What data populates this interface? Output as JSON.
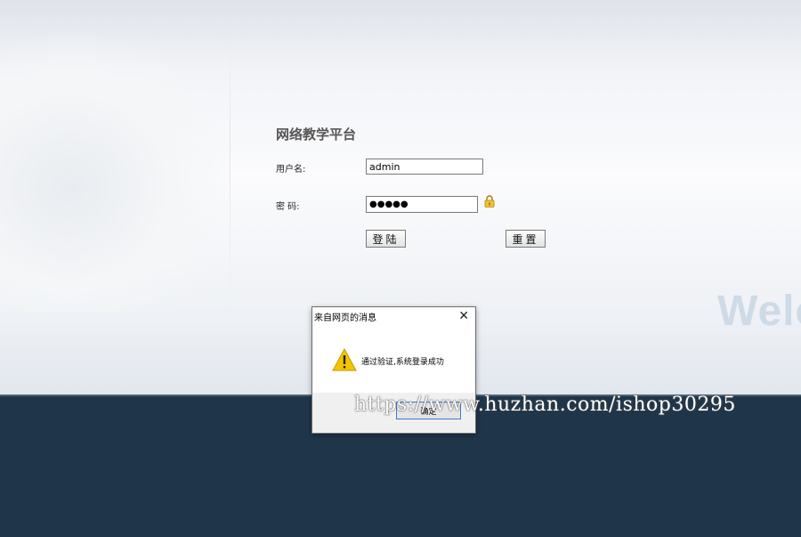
{
  "form": {
    "title": "网络教学平台",
    "username_label": "用户名:",
    "username_value": "admin",
    "password_label": "密 码:",
    "password_value": "●●●●●",
    "login_label": "登陆",
    "reset_label": "重置"
  },
  "background": {
    "welcome_text": "Welc"
  },
  "dialog": {
    "title": "来自网页的消息",
    "close_glyph": "✕",
    "message": "通过验证,系统登录成功",
    "ok_label": "确定"
  },
  "watermark": {
    "text": "https://www.huzhan.com/ishop30295"
  },
  "colors": {
    "bottom_band": "#1f364a",
    "title_text": "#555555",
    "focus_border": "#3a7bd5",
    "warning_yellow": "#f5c400"
  },
  "icons": {
    "lock": "lock-icon",
    "warning": "warning-icon",
    "close": "close-icon"
  }
}
